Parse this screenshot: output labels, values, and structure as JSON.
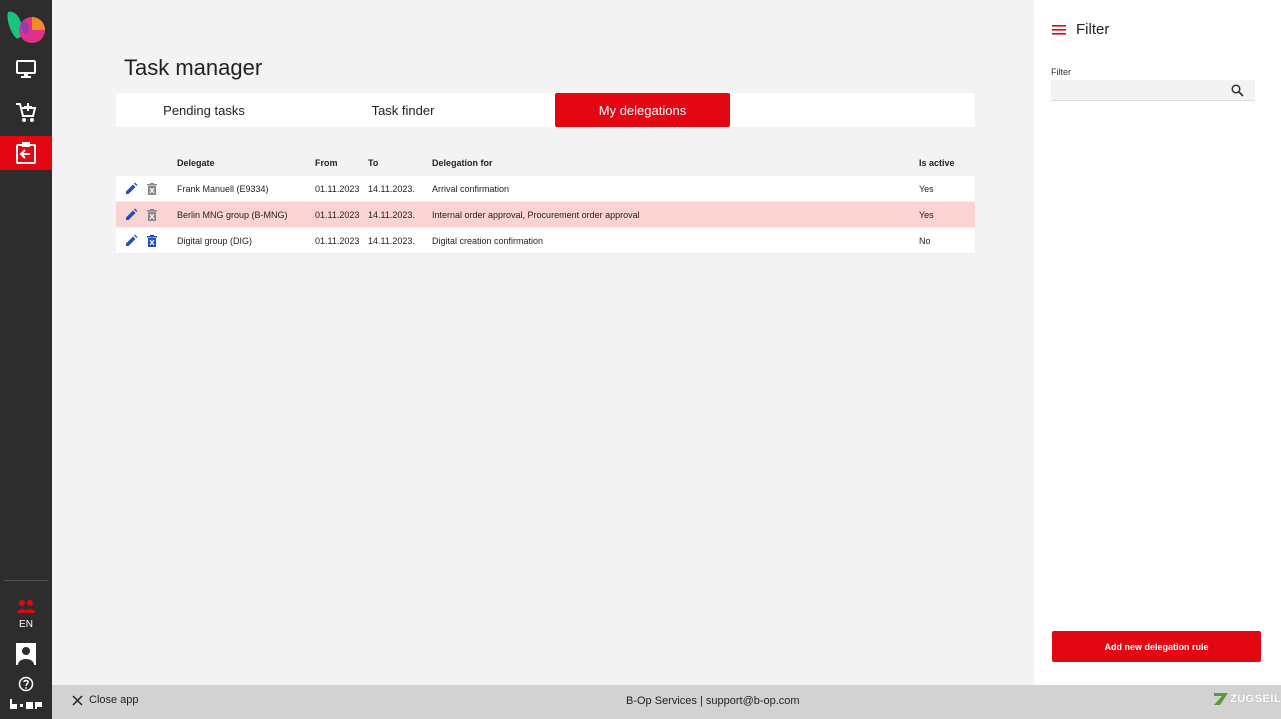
{
  "app": {
    "title": "Task manager"
  },
  "sidebar": {
    "language": "EN",
    "brand_text": "b-op"
  },
  "tabs": [
    {
      "label": "Pending tasks",
      "active": false
    },
    {
      "label": "Task finder",
      "active": false
    },
    {
      "label": "My delegations",
      "active": true
    }
  ],
  "table": {
    "columns": [
      "Delegate",
      "From",
      "To",
      "Delegation for",
      "Is active"
    ],
    "rows": [
      {
        "delegate": "Frank Manuell (E9334)",
        "from": "01.11.2023",
        "to": "14.11.2023.",
        "for": "Arrival confirmation",
        "active": "Yes"
      },
      {
        "delegate": "Berlin MNG group (B-MNG)",
        "from": "01.11.2023",
        "to": "14.11.2023.",
        "for": "Internal order approval, Procurement order approval",
        "active": "Yes"
      },
      {
        "delegate": "Digital group (DIG)",
        "from": "01.11.2023",
        "to": "14.11.2023.",
        "for": "Digital creation confirmation",
        "active": "No"
      }
    ]
  },
  "filter": {
    "title": "Filter",
    "label": "Filter",
    "value": "",
    "placeholder": "",
    "add_button": "Add new delegation rule"
  },
  "footer": {
    "close_app": "Close app",
    "center": "B-Op Services | support@b-op.com",
    "brand": "ZUGSEIL"
  },
  "colors": {
    "accent": "#e30613",
    "sidebar": "#2d2d2d",
    "highlight_row": "#fcd3d3",
    "icon_blue": "#1f4fbf"
  }
}
